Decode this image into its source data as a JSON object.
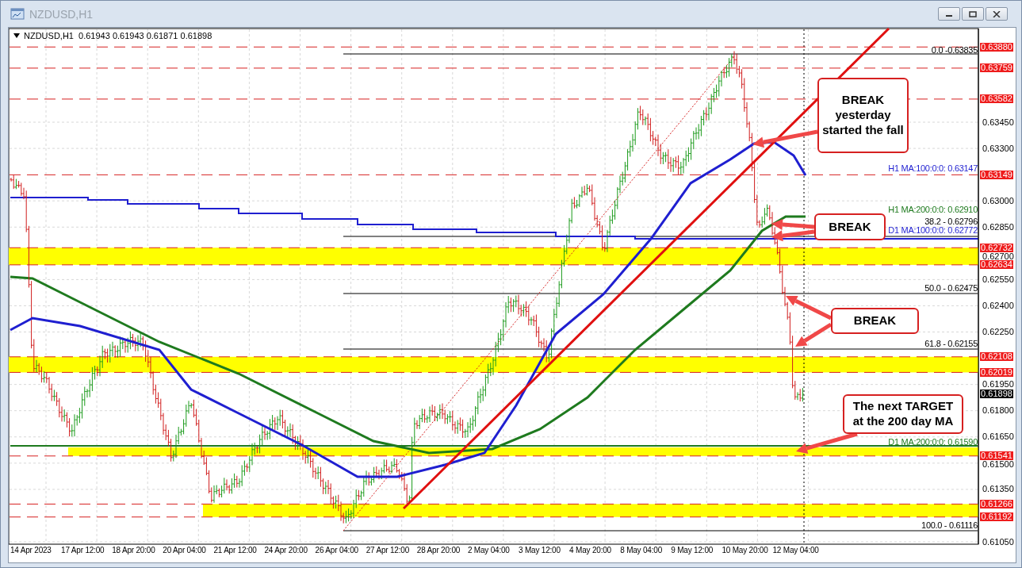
{
  "window": {
    "title": "NZDUSD,H1"
  },
  "chart": {
    "symbol": "NZDUSD,H1",
    "quote": [
      "0.61943",
      "0.61943",
      "0.61871",
      "0.61898"
    ],
    "price_ticks": [
      "0.63450",
      "0.63300",
      "0.63000",
      "0.62850",
      "0.62700",
      "0.62550",
      "0.62400",
      "0.62250",
      "0.61950",
      "0.61800",
      "0.61650",
      "0.61500",
      "0.61350",
      "0.61050"
    ],
    "price_levels": [
      {
        "label": "0.63880",
        "kind": "level"
      },
      {
        "label": "0.63759",
        "kind": "level"
      },
      {
        "label": "0.63582",
        "kind": "level"
      },
      {
        "label": "0.63149",
        "kind": "level"
      },
      {
        "label": "0.62732",
        "kind": "level"
      },
      {
        "label": "0.62634",
        "kind": "level"
      },
      {
        "label": "0.62108",
        "kind": "level"
      },
      {
        "label": "0.62019",
        "kind": "level"
      },
      {
        "label": "0.61898",
        "kind": "bid"
      },
      {
        "label": "0.61541",
        "kind": "level"
      },
      {
        "label": "0.61266",
        "kind": "level"
      },
      {
        "label": "0.61192",
        "kind": "level"
      }
    ],
    "fib_labels": [
      "0.0 -0.63835",
      "38.2 - 0.62796",
      "50.0 - 0.62475",
      "61.8 - 0.62155",
      "100.0 - 0.61116"
    ],
    "ma_labels": [
      {
        "text": "H1 MA:100:0:0: 0.63147",
        "color": "#1f1fd0"
      },
      {
        "text": "H1 MA:200:0:0: 0.62910",
        "color": "#1e7a1e"
      },
      {
        "text": "D1 MA:100:0:0: 0.62772",
        "color": "#1f1fd0"
      },
      {
        "text": "D1 MA:200:0:0: 0.61590",
        "color": "#1e7a1e"
      }
    ],
    "callouts": [
      "BREAK yesterday started the fall",
      "BREAK",
      "BREAK",
      "The next TARGET at the 200 day MA"
    ],
    "time_labels": [
      "14 Apr 2023",
      "17 Apr 12:00",
      "18 Apr 20:00",
      "20 Apr 04:00",
      "21 Apr 12:00",
      "24 Apr 20:00",
      "26 Apr 04:00",
      "27 Apr 12:00",
      "28 Apr 20:00",
      "2 May 04:00",
      "3 May 12:00",
      "4 May 20:00",
      "8 May 04:00",
      "9 May 12:00",
      "10 May 20:00",
      "12 May 04:00"
    ]
  }
}
